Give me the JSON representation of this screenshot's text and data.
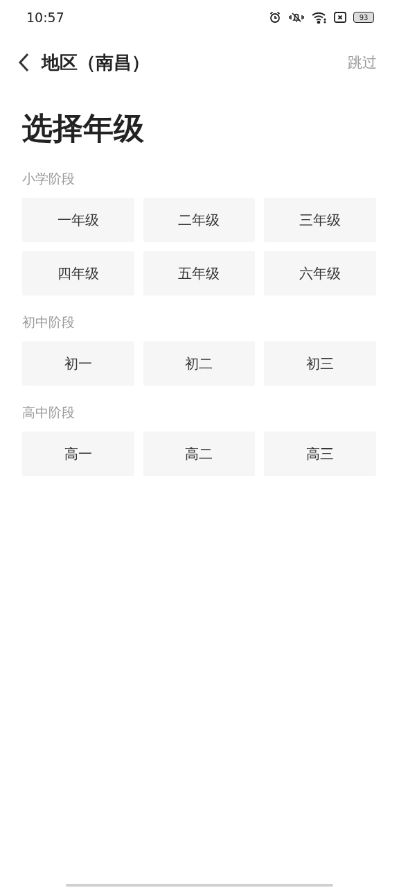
{
  "status_bar": {
    "time": "10:57",
    "battery": "93"
  },
  "nav": {
    "title": "地区（南昌）",
    "skip": "跳过"
  },
  "heading": "选择年级",
  "sections": [
    {
      "title": "小学阶段",
      "grades": [
        "一年级",
        "二年级",
        "三年级",
        "四年级",
        "五年级",
        "六年级"
      ]
    },
    {
      "title": "初中阶段",
      "grades": [
        "初一",
        "初二",
        "初三"
      ]
    },
    {
      "title": "高中阶段",
      "grades": [
        "高一",
        "高二",
        "高三"
      ]
    }
  ]
}
